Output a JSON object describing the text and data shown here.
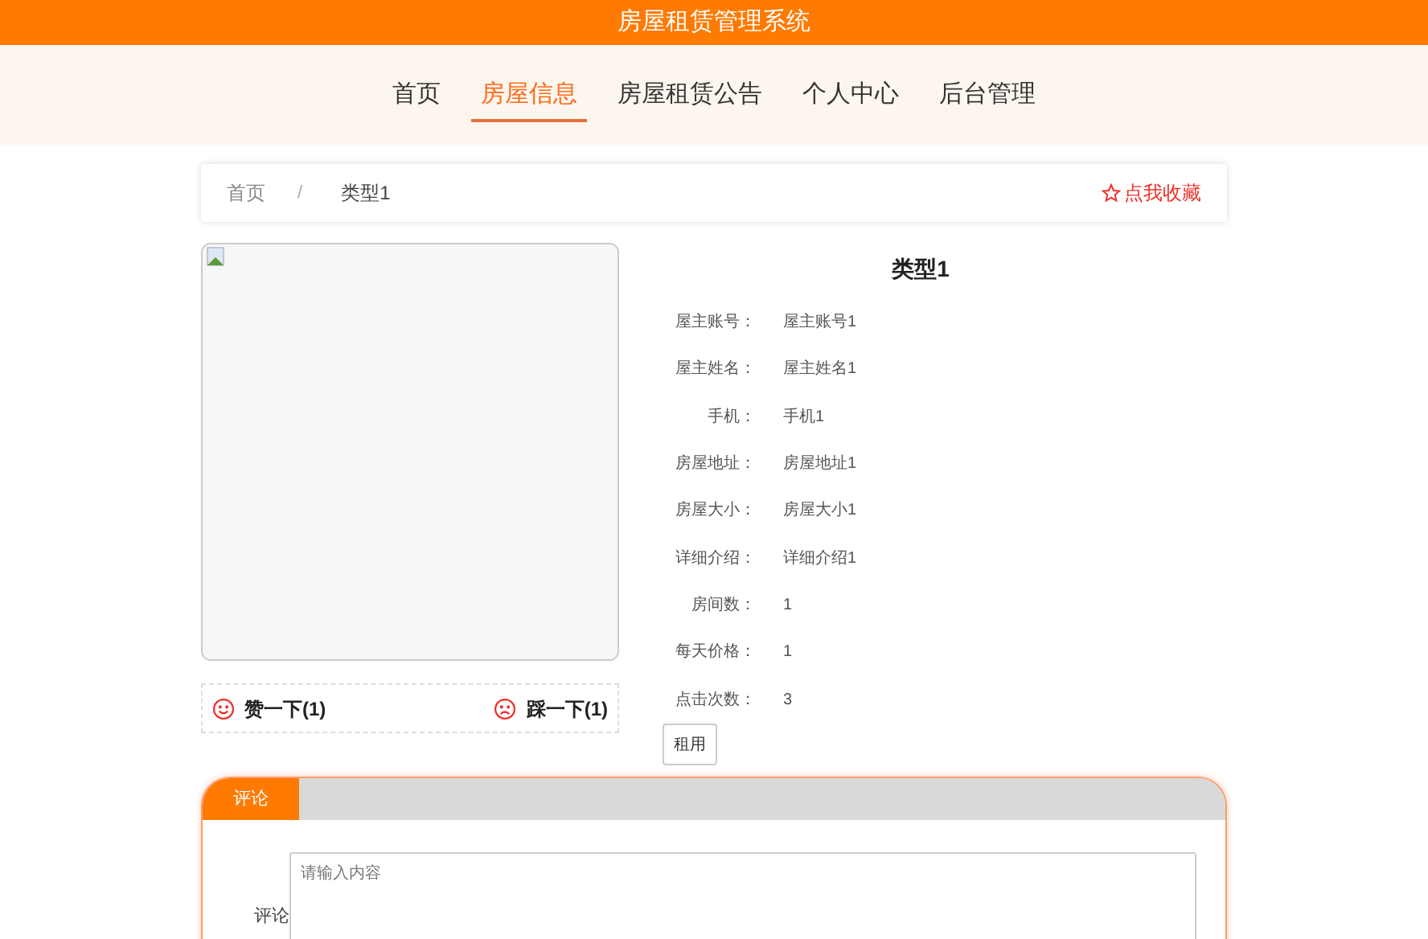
{
  "header": {
    "title": "房屋租赁管理系统"
  },
  "nav": [
    {
      "label": "首页",
      "selected": false
    },
    {
      "label": "房屋信息",
      "selected": true
    },
    {
      "label": "房屋租赁公告",
      "selected": false
    },
    {
      "label": "个人中心",
      "selected": false
    },
    {
      "label": "后台管理",
      "selected": false
    }
  ],
  "breadcrumb": [
    "首页",
    "类型1"
  ],
  "breadcrumb_separator": "/",
  "favorite": "点我收藏",
  "votes": {
    "like": "赞一下(1)",
    "dislike": "踩一下(1)"
  },
  "detail": {
    "title": "类型1",
    "fields": [
      {
        "label": "屋主账号：",
        "value": "屋主账号1"
      },
      {
        "label": "屋主姓名：",
        "value": "屋主姓名1"
      },
      {
        "label": "手机：",
        "value": "手机1"
      },
      {
        "label": "房屋地址：",
        "value": "房屋地址1"
      },
      {
        "label": "房屋大小：",
        "value": "房屋大小1"
      },
      {
        "label": "详细介绍：",
        "value": "详细介绍1"
      },
      {
        "label": "房间数：",
        "value": "1"
      },
      {
        "label": "每天价格：",
        "value": "1"
      },
      {
        "label": "点击次数：",
        "value": "3"
      }
    ],
    "button": "租用"
  },
  "comments": {
    "tabs": [
      {
        "label": "评论",
        "selected": true
      }
    ],
    "field_label": "评论",
    "placeholder": "请输入内容"
  }
}
